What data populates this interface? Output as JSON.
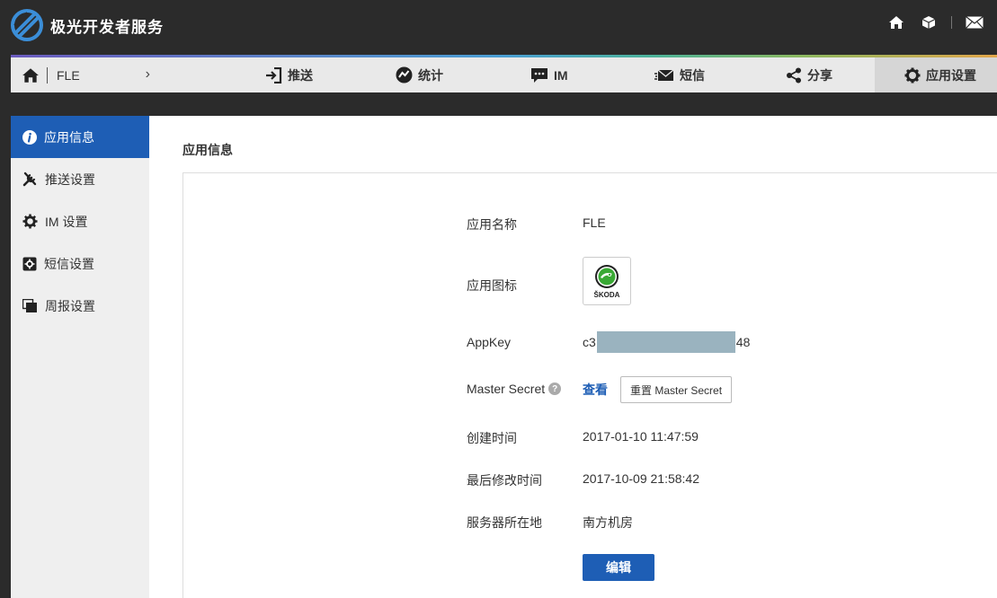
{
  "brand": {
    "title": "极光开发者服务"
  },
  "top_icons": [
    "home-icon",
    "cube-icon",
    "mail-icon"
  ],
  "nav": {
    "app_name": "FLE",
    "chevron": "›",
    "items": [
      {
        "label": "推送",
        "icon": "push-icon"
      },
      {
        "label": "统计",
        "icon": "stats-icon"
      },
      {
        "label": "IM",
        "icon": "chat-icon"
      },
      {
        "label": "短信",
        "icon": "sms-icon"
      },
      {
        "label": "分享",
        "icon": "share-icon"
      },
      {
        "label": "应用设置",
        "icon": "gear-icon",
        "active": true
      }
    ]
  },
  "sidebar": {
    "items": [
      {
        "label": "应用信息",
        "icon": "info-icon",
        "active": true
      },
      {
        "label": "推送设置",
        "icon": "tools-icon"
      },
      {
        "label": "IM 设置",
        "icon": "gear-icon"
      },
      {
        "label": "短信设置",
        "icon": "sms-settings-icon"
      },
      {
        "label": "周报设置",
        "icon": "report-icon"
      }
    ]
  },
  "main": {
    "section_title": "应用信息",
    "fields": {
      "name_label": "应用名称",
      "name_value": "FLE",
      "icon_label": "应用图标",
      "icon_brand": "ŠKODA",
      "appkey_label": "AppKey",
      "appkey_prefix": "c3",
      "appkey_suffix": "48",
      "secret_label": "Master Secret",
      "secret_help": "?",
      "secret_view": "查看",
      "secret_reset": "重置 Master Secret",
      "created_label": "创建时间",
      "created_value": "2017-01-10 11:47:59",
      "modified_label": "最后修改时间",
      "modified_value": "2017-10-09 21:58:42",
      "region_label": "服务器所在地",
      "region_value": "南方机房"
    },
    "edit_button": "编辑"
  },
  "colors": {
    "accent": "#1e5eb5",
    "topbar": "#2b2b2b",
    "mask": "#9ab3bf"
  }
}
